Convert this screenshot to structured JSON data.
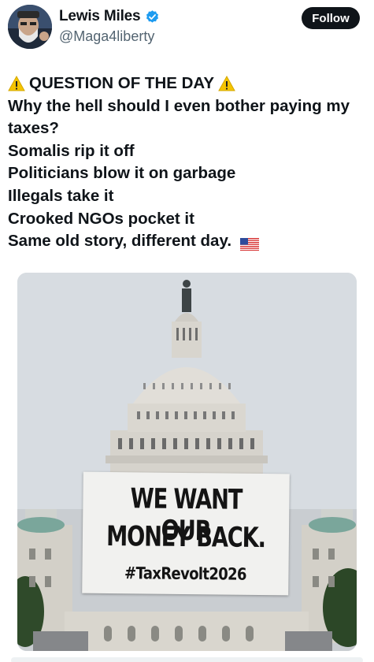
{
  "author": {
    "display_name": "Lewis Miles",
    "handle": "@Maga4liberty",
    "verified_icon": "verified-badge-icon",
    "avatar_icon": "avatar"
  },
  "actions": {
    "follow_label": "Follow"
  },
  "post": {
    "title": "QUESTION OF THE DAY",
    "lines": [
      "Why the hell should I even bother paying my taxes?",
      "Somalis rip it off",
      "Politicians blow it on garbage",
      "Illegals take it",
      "Crooked NGOs pocket it",
      "Same old story, different day."
    ],
    "title_icon": "warning-icon",
    "end_icon": "us-flag-icon"
  },
  "media": {
    "banner_line1": "WE WANT OUR",
    "banner_line2": "MONEY BACK.",
    "banner_line3": "#TaxRevolt2026"
  },
  "colors": {
    "text": "#0f1419",
    "secondary_text": "#536471",
    "verified": "#1d9bf0",
    "follow_bg": "#0f1419",
    "warning": "#f5c400"
  }
}
